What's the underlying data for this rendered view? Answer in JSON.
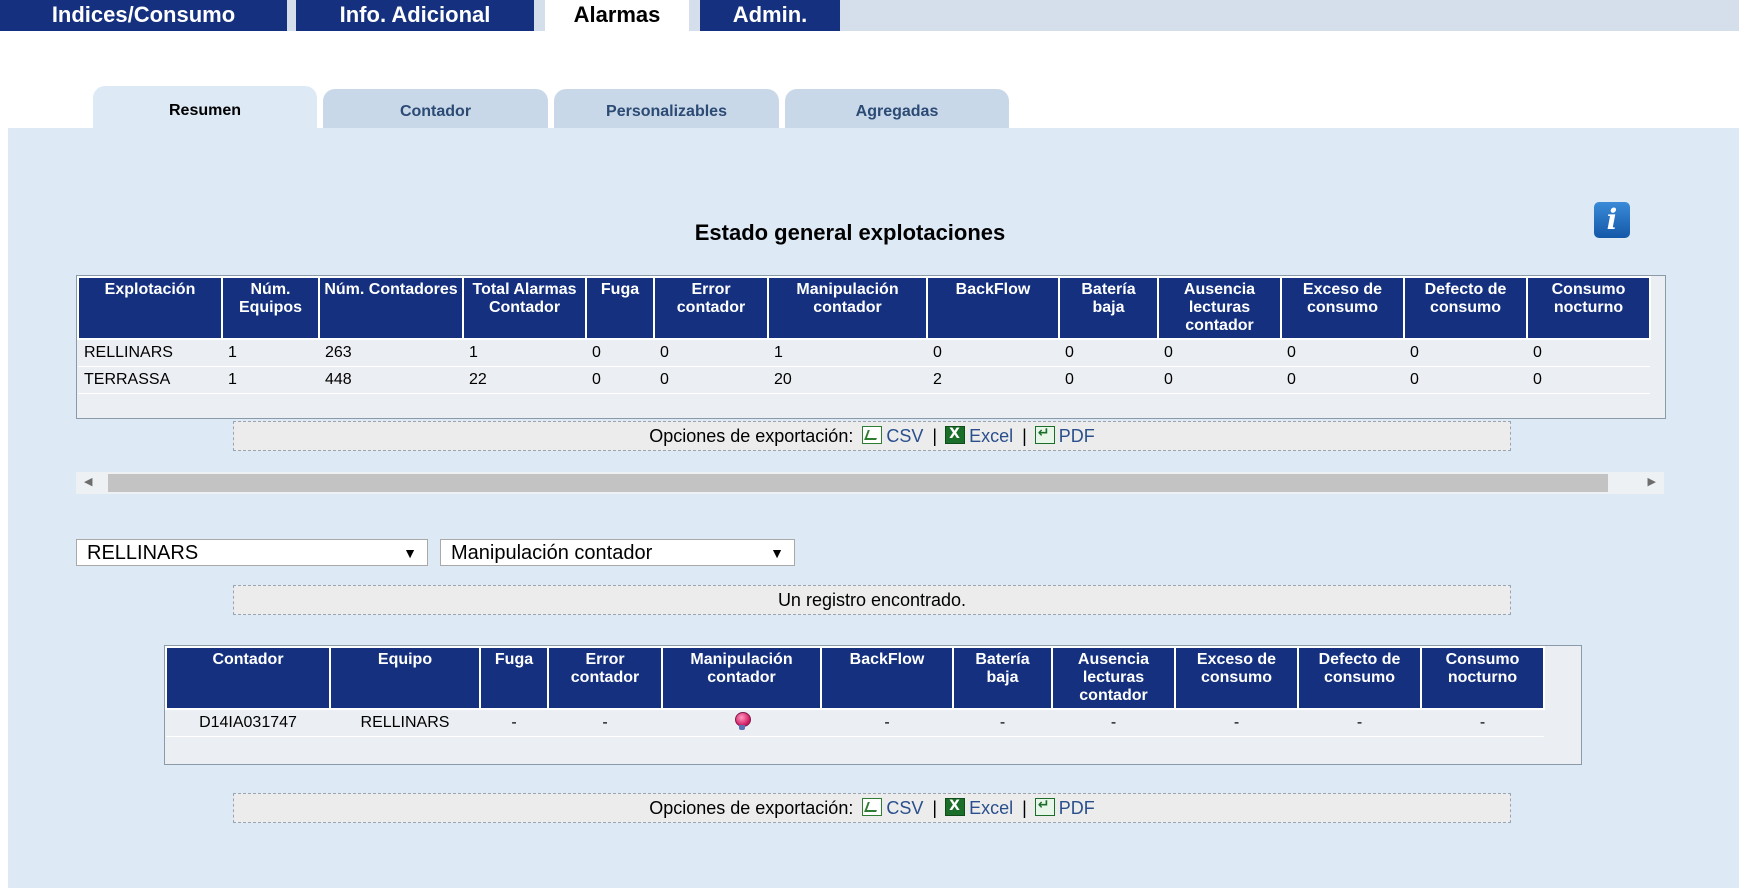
{
  "top_tabs": [
    "Indices/Consumo",
    "Info. Adicional",
    "Alarmas",
    "Admin."
  ],
  "sub_tabs": [
    "Resumen",
    "Contador",
    "Personalizables",
    "Agregadas"
  ],
  "summary": {
    "title": "Estado general explotaciones",
    "info_icon": "i",
    "columns": [
      "Explotación",
      "Núm. Equipos",
      "Núm. Contadores",
      "Total Alarmas Contador",
      "Fuga",
      "Error contador",
      "Manipulación contador",
      "BackFlow",
      "Batería baja",
      "Ausencia lecturas contador",
      "Exceso de consumo",
      "Defecto de consumo",
      "Consumo nocturno"
    ],
    "rows": [
      [
        "RELLINARS",
        "1",
        "263",
        "1",
        "0",
        "0",
        "1",
        "0",
        "0",
        "0",
        "0",
        "0",
        "0"
      ],
      [
        "TERRASSA",
        "1",
        "448",
        "22",
        "0",
        "0",
        "20",
        "2",
        "0",
        "0",
        "0",
        "0",
        "0"
      ]
    ]
  },
  "export": {
    "label": "Opciones de exportación:",
    "csv": "CSV",
    "excel": "Excel",
    "pdf": "PDF",
    "separator": "|"
  },
  "filters": {
    "explotacion": "RELLINARS",
    "alarma": "Manipulación contador"
  },
  "result_message": "Un registro encontrado.",
  "detail": {
    "columns": [
      "Contador",
      "Equipo",
      "Fuga",
      "Error contador",
      "Manipulación contador",
      "BackFlow",
      "Batería baja",
      "Ausencia lecturas contador",
      "Exceso de consumo",
      "Defecto de consumo",
      "Consumo nocturno"
    ],
    "row": {
      "contador": "D14IA031747",
      "equipo": "RELLINARS",
      "fuga": "-",
      "error": "-",
      "manipulacion_icon": "alarm-bulb-icon",
      "backflow": "-",
      "bateria": "-",
      "ausencia": "-",
      "exceso": "-",
      "defecto": "-",
      "nocturno": "-"
    }
  },
  "colors": {
    "nav_blue": "#14307e",
    "panel_bg": "#dde9f5"
  }
}
